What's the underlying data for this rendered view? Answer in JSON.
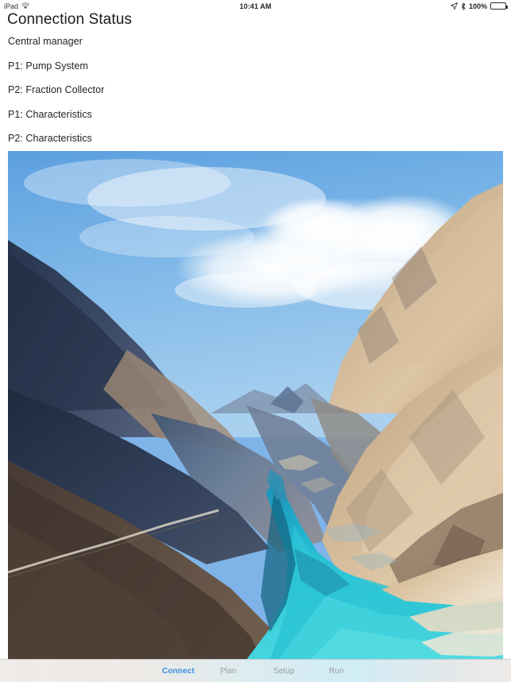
{
  "status_bar": {
    "carrier": "iPad",
    "wifi_icon": "wifi-icon",
    "time": "10:41 AM",
    "location_icon": "location-arrow-icon",
    "bluetooth_icon": "bluetooth-icon",
    "battery_percent": "100%",
    "battery_icon": "battery-full-icon"
  },
  "header": {
    "title": "Connection Status"
  },
  "status_list": {
    "rows": [
      {
        "label": "Central manager",
        "state_icon": "green-checkmark-icon",
        "checked": true
      },
      {
        "label": "P1: Pump System",
        "state_icon": "green-checkmark-icon",
        "checked": true
      },
      {
        "label": "P2: Fraction Collector",
        "state_icon": "green-checkmark-icon",
        "checked": true
      },
      {
        "label": "P1: Characteristics",
        "state_icon": "green-checkmark-icon",
        "checked": true
      },
      {
        "label": "P2: Characteristics",
        "state_icon": "green-checkmark-icon",
        "checked": true
      }
    ]
  },
  "photo": {
    "description": "Mountain valley landscape with turquoise river",
    "sky_color": "#7fb4e8",
    "water_color": "#2ec6d8",
    "left_ridge_color": "#3c4a63",
    "right_slope_color": "#c7ac8c"
  },
  "tab_bar": {
    "tabs": [
      {
        "label": "Connect",
        "active": true
      },
      {
        "label": "Plan",
        "active": false
      },
      {
        "label": "Setup",
        "active": false
      },
      {
        "label": "Run",
        "active": false
      }
    ],
    "active_color": "#3b8ee0",
    "inactive_color": "#9b9b9b"
  }
}
